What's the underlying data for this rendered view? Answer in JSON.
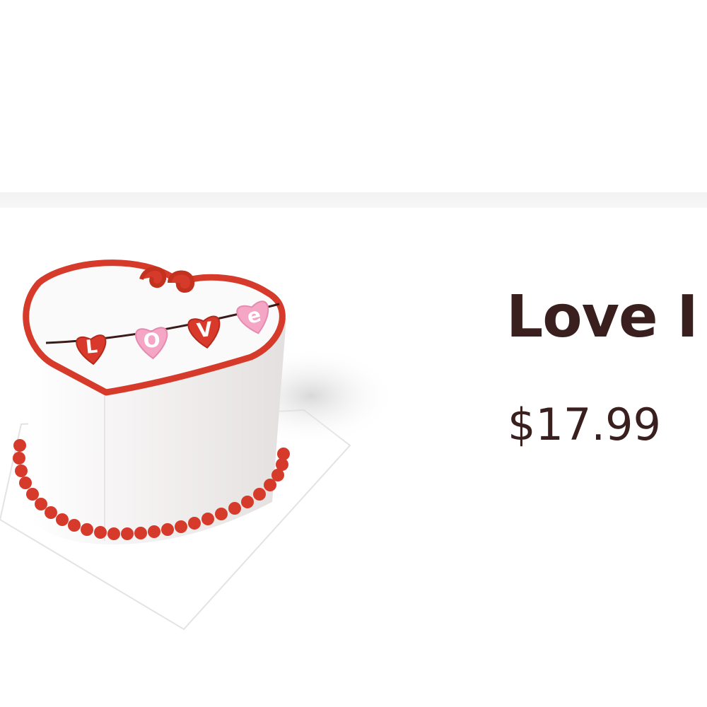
{
  "product": {
    "name": "Love I",
    "price": "$17.99",
    "image_icon": "heart-cake-image",
    "cake_text": "Love"
  },
  "colors": {
    "text": "#3a1f1f",
    "frosting_red": "#d63a2a",
    "heart_pink": "#f4a6c4",
    "cake_white": "#f7f4f4"
  }
}
